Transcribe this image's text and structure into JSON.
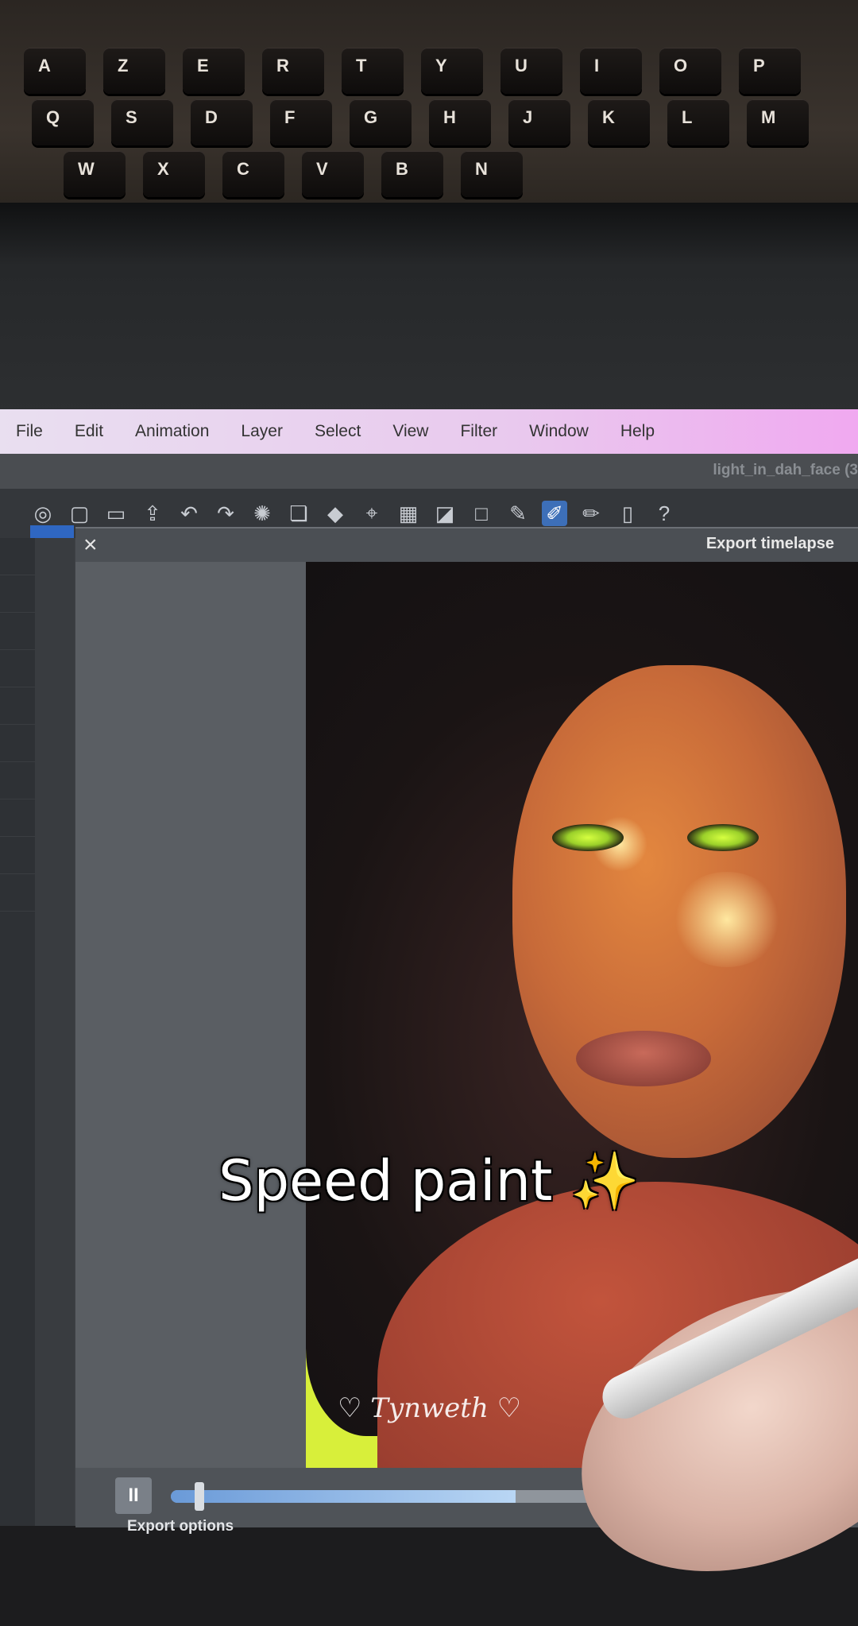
{
  "keyboard": {
    "row1": [
      "A",
      "Z",
      "E",
      "R",
      "T",
      "Y",
      "U",
      "I",
      "O",
      "P"
    ],
    "row2": [
      "Q",
      "S",
      "D",
      "F",
      "G",
      "H",
      "J",
      "K",
      "L",
      "M"
    ],
    "row3": [
      "W",
      "X",
      "C",
      "V",
      "B",
      "N"
    ]
  },
  "menubar": {
    "items": [
      "File",
      "Edit",
      "Animation",
      "Layer",
      "Select",
      "View",
      "Filter",
      "Window",
      "Help"
    ]
  },
  "document": {
    "title": "light_in_dah_face (3"
  },
  "dialog": {
    "close_label": "×",
    "title": "Export timelapse",
    "export_options_label": "Export options",
    "pause_label": "II",
    "timeline_progress": 0.62
  },
  "artwork": {
    "signature": "♡ Tynweth ♡"
  },
  "caption": "Speed paint ✨",
  "icons": [
    "pause-icon",
    "undo-icon",
    "redo-icon",
    "close-icon",
    "help-icon"
  ]
}
